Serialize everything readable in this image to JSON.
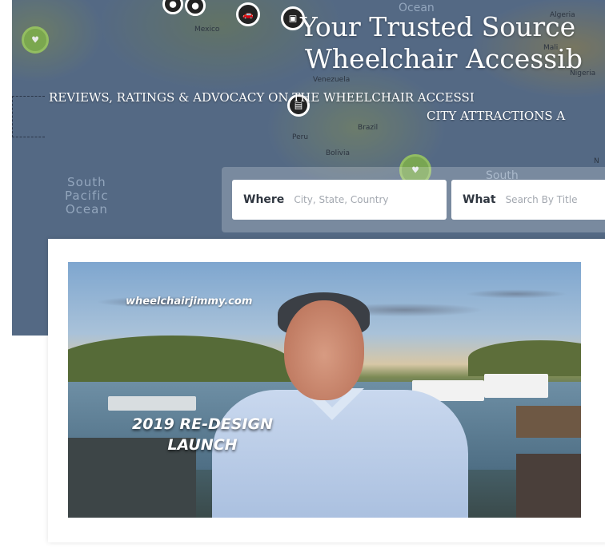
{
  "hero": {
    "title_line1": "Your Trusted Source",
    "title_line2": "Wheelchair Accessib",
    "subtitle_line1": "REVIEWS, RATINGS & ADVOCACY ON THE WHEELCHAIR ACCESSI",
    "subtitle_line2": "CITY ATTRACTIONS A",
    "map_labels": {
      "mexico": "Mexico",
      "venezuela": "Venezuela",
      "peru": "Peru",
      "brazil": "Brazil",
      "bolivia": "Bolivia",
      "algeria": "Algeria",
      "mali": "Mali",
      "nigeria": "Nigeria",
      "ocean_top": "Ocean",
      "south_pacific": "South\nPacific\nOcean",
      "south_atlantic": "South",
      "edge_n": "N"
    }
  },
  "search": {
    "where_label": "Where",
    "where_placeholder": "City, State, Country",
    "what_label": "What",
    "what_placeholder": "Search By Title"
  },
  "video": {
    "watermark": "wheelchairjimmy.com",
    "launch_line1": "2019 RE-DESIGN",
    "launch_line2": "LAUNCH"
  },
  "colors": {
    "map_ocean": "#5f7591",
    "card_bg": "#ffffff",
    "title_text": "#ffffff"
  }
}
